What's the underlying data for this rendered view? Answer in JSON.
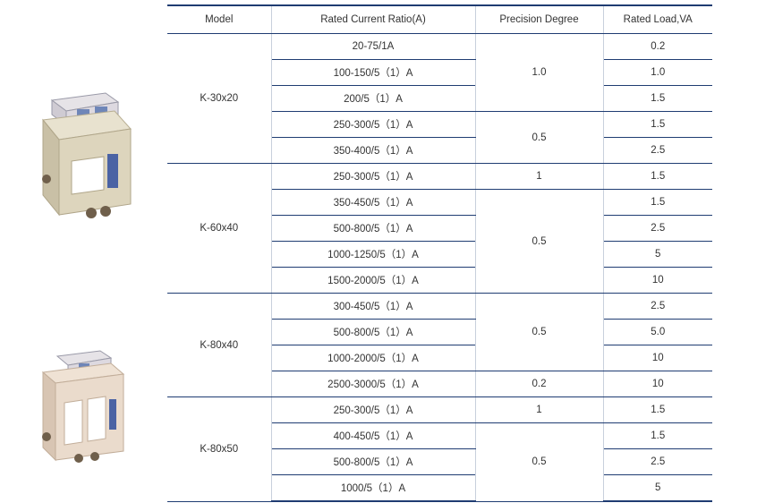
{
  "headers": {
    "model": "Model",
    "ratio": "Rated Current Ratio(A)",
    "precision": "Precision Degree",
    "load": "Rated Load,VA"
  },
  "groups": [
    {
      "model": "K-30x20",
      "rows": [
        {
          "ratio": "20-75/1A",
          "load": "0.2"
        },
        {
          "ratio": "100-150/5（1）A",
          "load": "1.0"
        },
        {
          "ratio": "200/5（1）A",
          "load": "1.5"
        },
        {
          "ratio": "250-300/5（1）A",
          "load": "1.5"
        },
        {
          "ratio": "350-400/5（1）A",
          "load": "2.5"
        }
      ],
      "precision": [
        "1.0",
        "0.5"
      ]
    },
    {
      "model": "K-60x40",
      "rows": [
        {
          "ratio": "250-300/5（1）A",
          "load": "1.5"
        },
        {
          "ratio": "350-450/5（1）A",
          "load": "1.5"
        },
        {
          "ratio": "500-800/5（1）A",
          "load": "2.5"
        },
        {
          "ratio": "1000-1250/5（1）A",
          "load": "5"
        },
        {
          "ratio": "1500-2000/5（1）A",
          "load": "10"
        }
      ],
      "precision": [
        "1",
        "0.5"
      ]
    },
    {
      "model": "K-80x40",
      "rows": [
        {
          "ratio": "300-450/5（1）A",
          "load": "2.5"
        },
        {
          "ratio": "500-800/5（1）A",
          "load": "5.0"
        },
        {
          "ratio": "1000-2000/5（1）A",
          "load": "10"
        },
        {
          "ratio": "2500-3000/5（1）A",
          "load": "10"
        }
      ],
      "precision": [
        "0.5",
        "0.2"
      ]
    },
    {
      "model": "K-80x50",
      "rows": [
        {
          "ratio": "250-300/5（1）A",
          "load": "1.5"
        },
        {
          "ratio": "400-450/5（1）A",
          "load": "1.5"
        },
        {
          "ratio": "500-800/5（1）A",
          "load": "2.5"
        },
        {
          "ratio": "1000/5（1）A",
          "load": "5"
        }
      ],
      "precision": [
        "1",
        "0.5"
      ]
    }
  ]
}
